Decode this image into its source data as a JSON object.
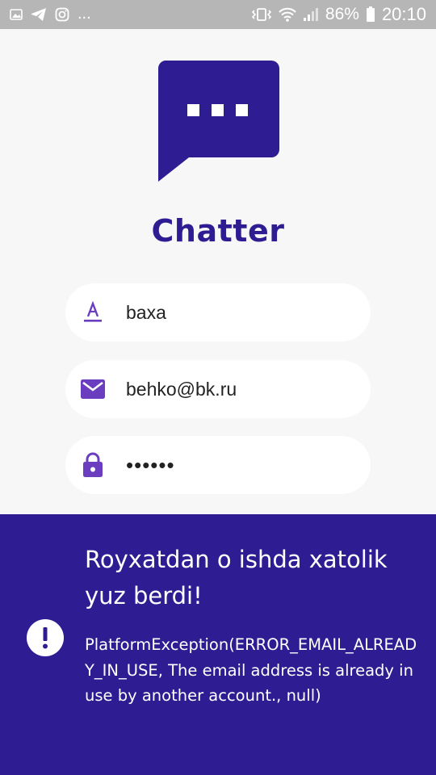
{
  "status_bar": {
    "notification_icons": [
      "image-icon",
      "telegram-icon",
      "instagram-icon"
    ],
    "more_indicator": "...",
    "battery_percent": "86%",
    "time": "20:10",
    "system_icons": [
      "vibrate-icon",
      "wifi-icon",
      "signal-icon",
      "battery-icon"
    ]
  },
  "app": {
    "logo_icon": "chat-bubble-icon",
    "title": "Chatter",
    "brand_color": "#2e1c92",
    "accent_icon_color": "#6a3ebf"
  },
  "form": {
    "username": {
      "icon": "text-format-icon",
      "value": "baxa"
    },
    "email": {
      "icon": "mail-icon",
      "value": "behko@bk.ru"
    },
    "password": {
      "icon": "lock-icon",
      "value": "••••••"
    }
  },
  "error": {
    "icon": "alert-circle-icon",
    "title": "Royxatdan o ishda xatolik yuz berdi!",
    "message": "PlatformException(ERROR_EMAIL_ALREADY_IN_USE, The email address is already in use by another account., null)"
  }
}
